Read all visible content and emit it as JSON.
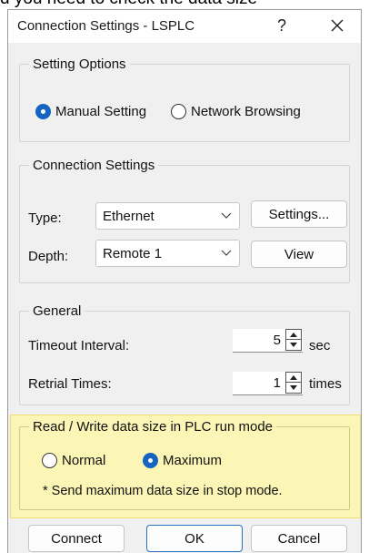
{
  "background_text": "d you need to check the data size",
  "window": {
    "title": "Connection Settings - LSPLC",
    "help_glyph": "?"
  },
  "setting_options": {
    "legend": "Setting Options",
    "manual_label": "Manual Setting",
    "network_label": "Network Browsing",
    "selected": "Manual Setting"
  },
  "connection_settings": {
    "legend": "Connection Settings",
    "type_label": "Type:",
    "type_value": "Ethernet",
    "settings_button": "Settings...",
    "depth_label": "Depth:",
    "depth_value": "Remote 1",
    "view_button": "View"
  },
  "general": {
    "legend": "General",
    "timeout_label": "Timeout Interval:",
    "timeout_value": "5",
    "timeout_unit": "sec",
    "retrial_label": "Retrial Times:",
    "retrial_value": "1",
    "retrial_unit": "times"
  },
  "read_write": {
    "legend": "Read / Write data size in PLC run mode",
    "normal_label": "Normal",
    "maximum_label": "Maximum",
    "selected": "Maximum",
    "note": "* Send maximum data size in stop mode.",
    "highlight_color": "#fbf6b6"
  },
  "footer": {
    "connect": "Connect",
    "ok": "OK",
    "cancel": "Cancel"
  },
  "colors": {
    "accent": "#1565c0",
    "dialog_bg": "#f0f0f0"
  }
}
